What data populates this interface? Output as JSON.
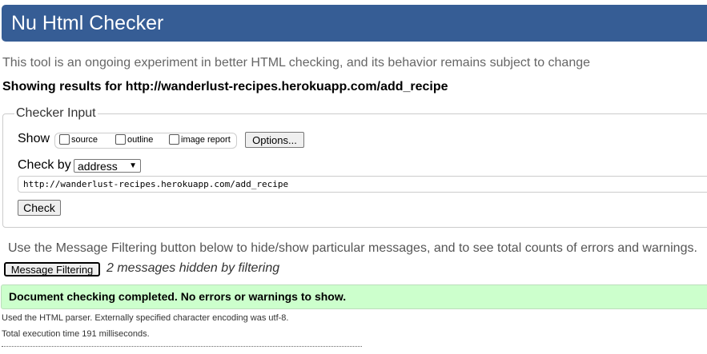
{
  "header": {
    "title": "Nu Html Checker",
    "color": "#365d95"
  },
  "intro": "This tool is an ongoing experiment in better HTML checking, and its behavior remains subject to change",
  "showing": "Showing results for http://wanderlust-recipes.herokuapp.com/add_recipe",
  "form": {
    "legend": "Checker Input",
    "show_label": "Show",
    "checkboxes": [
      {
        "label": "source",
        "checked": false
      },
      {
        "label": "outline",
        "checked": false
      },
      {
        "label": "image report",
        "checked": false
      }
    ],
    "options_button": "Options...",
    "checkby_label": "Check by",
    "checkby_value": "address",
    "url_value": "http://wanderlust-recipes.herokuapp.com/add_recipe",
    "check_button": "Check"
  },
  "filter_hint": "Use the Message Filtering button below to hide/show particular messages, and to see total counts of errors and warnings.",
  "message_filtering_button": "Message Filtering",
  "hidden_count": "2 messages hidden by filtering",
  "success": {
    "text": "Document checking completed. No errors or warnings to show.",
    "color": "#ccffcc"
  },
  "parser_info": "Used the HTML parser. Externally specified character encoding was utf-8.",
  "execution_time": "Total execution time 191 milliseconds."
}
